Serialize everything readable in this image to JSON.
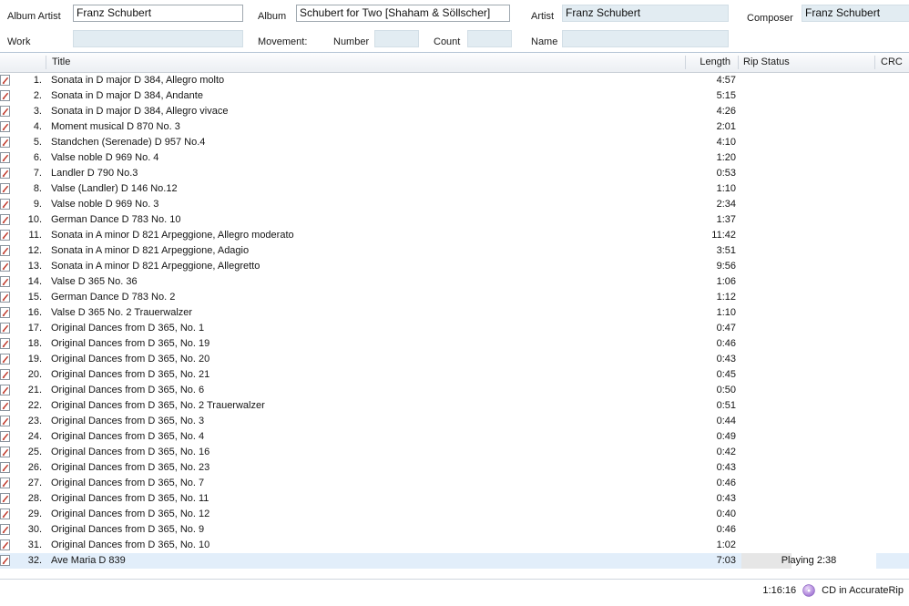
{
  "header": {
    "fields": [
      {
        "name": "album-artist",
        "label": "Album Artist",
        "value": "Franz Schubert",
        "placeholder": "",
        "editable": true
      },
      {
        "name": "work",
        "label": "Work",
        "value": "",
        "placeholder": "",
        "editable": false
      },
      {
        "name": "album",
        "label": "Album",
        "value": "Schubert for Two [Shaham & Söllscher]",
        "placeholder": "",
        "editable": true
      },
      {
        "name": "movement",
        "label": "Movement:",
        "value": "",
        "placeholder": "",
        "editable": false
      },
      {
        "name": "number",
        "label": "Number",
        "value": "",
        "placeholder": "",
        "editable": false
      },
      {
        "name": "count",
        "label": "Count",
        "value": "",
        "placeholder": "",
        "editable": false
      },
      {
        "name": "artist",
        "label": "Artist",
        "value": "Franz Schubert",
        "placeholder": "",
        "editable": false
      },
      {
        "name": "name",
        "label": "Name",
        "value": "",
        "placeholder": "",
        "editable": false
      },
      {
        "name": "composer",
        "label": "Composer",
        "value": "Franz Schubert",
        "placeholder": "",
        "editable": false
      }
    ],
    "labels": {
      "album_artist": "Album Artist",
      "work": "Work",
      "album": "Album",
      "movement": "Movement:",
      "number": "Number",
      "count": "Count",
      "artist": "Artist",
      "name": "Name",
      "composer": "Composer"
    },
    "values": {
      "album_artist": "Franz Schubert",
      "work": "",
      "album": "Schubert for Two [Shaham & Söllscher]",
      "number": "",
      "count": "",
      "artist": "Franz Schubert",
      "name": "",
      "composer": "Franz Schubert"
    }
  },
  "table": {
    "columns": {
      "check": "",
      "number": "",
      "title": "Title",
      "length": "Length",
      "rip_status": "Rip Status",
      "crc": "CRC"
    },
    "checkbox_glyph": "check-mark",
    "selected_row_index": 31,
    "rows": [
      {
        "checked": true,
        "num": "1.",
        "title": "Sonata in D major D 384, Allegro molto",
        "length": "4:57",
        "rip_status": "",
        "crc": ""
      },
      {
        "checked": true,
        "num": "2.",
        "title": "Sonata in D major D 384, Andante",
        "length": "5:15",
        "rip_status": "",
        "crc": ""
      },
      {
        "checked": true,
        "num": "3.",
        "title": "Sonata in D major D 384, Allegro vivace",
        "length": "4:26",
        "rip_status": "",
        "crc": ""
      },
      {
        "checked": true,
        "num": "4.",
        "title": "Moment musical D 870 No. 3",
        "length": "2:01",
        "rip_status": "",
        "crc": ""
      },
      {
        "checked": true,
        "num": "5.",
        "title": "Standchen (Serenade) D 957 No.4",
        "length": "4:10",
        "rip_status": "",
        "crc": ""
      },
      {
        "checked": true,
        "num": "6.",
        "title": "Valse noble D 969 No. 4",
        "length": "1:20",
        "rip_status": "",
        "crc": ""
      },
      {
        "checked": true,
        "num": "7.",
        "title": "Landler D 790 No.3",
        "length": "0:53",
        "rip_status": "",
        "crc": ""
      },
      {
        "checked": true,
        "num": "8.",
        "title": "Valse (Landler) D 146 No.12",
        "length": "1:10",
        "rip_status": "",
        "crc": ""
      },
      {
        "checked": true,
        "num": "9.",
        "title": "Valse noble D 969 No. 3",
        "length": "2:34",
        "rip_status": "",
        "crc": ""
      },
      {
        "checked": true,
        "num": "10.",
        "title": "German Dance D 783 No. 10",
        "length": "1:37",
        "rip_status": "",
        "crc": ""
      },
      {
        "checked": true,
        "num": "11.",
        "title": "Sonata in A minor D 821 Arpeggione, Allegro moderato",
        "length": "11:42",
        "rip_status": "",
        "crc": ""
      },
      {
        "checked": true,
        "num": "12.",
        "title": "Sonata in A minor D 821 Arpeggione, Adagio",
        "length": "3:51",
        "rip_status": "",
        "crc": ""
      },
      {
        "checked": true,
        "num": "13.",
        "title": "Sonata in A minor D 821 Arpeggione, Allegretto",
        "length": "9:56",
        "rip_status": "",
        "crc": ""
      },
      {
        "checked": true,
        "num": "14.",
        "title": "Valse D 365 No. 36",
        "length": "1:06",
        "rip_status": "",
        "crc": ""
      },
      {
        "checked": true,
        "num": "15.",
        "title": "German Dance D 783 No. 2",
        "length": "1:12",
        "rip_status": "",
        "crc": ""
      },
      {
        "checked": true,
        "num": "16.",
        "title": "Valse D 365 No. 2 Trauerwalzer",
        "length": "1:10",
        "rip_status": "",
        "crc": ""
      },
      {
        "checked": true,
        "num": "17.",
        "title": "Original Dances from D 365, No. 1",
        "length": "0:47",
        "rip_status": "",
        "crc": ""
      },
      {
        "checked": true,
        "num": "18.",
        "title": "Original Dances from D 365, No. 19",
        "length": "0:46",
        "rip_status": "",
        "crc": ""
      },
      {
        "checked": true,
        "num": "19.",
        "title": "Original Dances from D 365, No. 20",
        "length": "0:43",
        "rip_status": "",
        "crc": ""
      },
      {
        "checked": true,
        "num": "20.",
        "title": "Original Dances from D 365, No. 21",
        "length": "0:45",
        "rip_status": "",
        "crc": ""
      },
      {
        "checked": true,
        "num": "21.",
        "title": "Original Dances from D 365, No. 6",
        "length": "0:50",
        "rip_status": "",
        "crc": ""
      },
      {
        "checked": true,
        "num": "22.",
        "title": "Original Dances from D 365, No. 2 Trauerwalzer",
        "length": "0:51",
        "rip_status": "",
        "crc": ""
      },
      {
        "checked": true,
        "num": "23.",
        "title": "Original Dances from D 365, No. 3",
        "length": "0:44",
        "rip_status": "",
        "crc": ""
      },
      {
        "checked": true,
        "num": "24.",
        "title": "Original Dances from D 365, No. 4",
        "length": "0:49",
        "rip_status": "",
        "crc": ""
      },
      {
        "checked": true,
        "num": "25.",
        "title": "Original Dances from D 365, No. 16",
        "length": "0:42",
        "rip_status": "",
        "crc": ""
      },
      {
        "checked": true,
        "num": "26.",
        "title": "Original Dances from D 365, No. 23",
        "length": "0:43",
        "rip_status": "",
        "crc": ""
      },
      {
        "checked": true,
        "num": "27.",
        "title": "Original Dances from D 365, No. 7",
        "length": "0:46",
        "rip_status": "",
        "crc": ""
      },
      {
        "checked": true,
        "num": "28.",
        "title": "Original Dances from D 365, No. 11",
        "length": "0:43",
        "rip_status": "",
        "crc": ""
      },
      {
        "checked": true,
        "num": "29.",
        "title": "Original Dances from D 365, No. 12",
        "length": "0:40",
        "rip_status": "",
        "crc": ""
      },
      {
        "checked": true,
        "num": "30.",
        "title": "Original Dances from D 365, No. 9",
        "length": "0:46",
        "rip_status": "",
        "crc": ""
      },
      {
        "checked": true,
        "num": "31.",
        "title": "Original Dances from D 365, No. 10",
        "length": "1:02",
        "rip_status": "",
        "crc": ""
      },
      {
        "checked": true,
        "num": "32.",
        "title": "Ave Maria D 839",
        "length": "7:03",
        "rip_status": "Playing 2:38",
        "crc": "",
        "progress_percent": 37
      }
    ]
  },
  "statusbar": {
    "total_time": "1:16:16",
    "accuraterip_label": "CD in AccurateRip",
    "accuraterip_icon": "cd-disc-icon"
  },
  "colors": {
    "selection": "#e2eefa",
    "readonly_field": "#e2ecf2",
    "check_mark": "#c0392b",
    "header_gradient_top": "#fdfdfe",
    "header_gradient_bottom": "#eceff3",
    "progress_fill": "#e6e6e6"
  }
}
